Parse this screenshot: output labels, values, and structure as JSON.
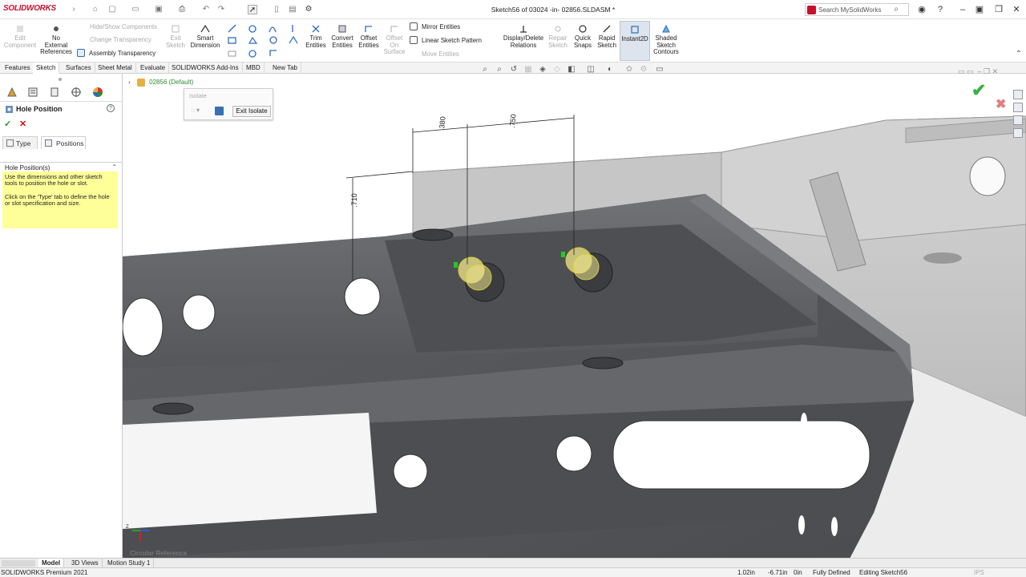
{
  "app": {
    "name": "SOLIDWORKS",
    "window_title": "Sketch56 of 03024 -in- 02856.SLDASM *"
  },
  "search": {
    "placeholder": "Search MySolidWorks"
  },
  "ribbon": {
    "edit_component": "Edit Component",
    "no_external_refs": "No External References",
    "hide_show": "Hide/Show Components",
    "change_transparency": "Change Transparency",
    "assembly_transparency": "Assembly Transparency",
    "exit_sketch": "Exit Sketch",
    "smart_dimension": "Smart Dimension",
    "trim": "Trim Entities",
    "convert": "Convert Entities",
    "offset": "Offset Entities",
    "offset_surface": "Offset On Surface",
    "mirror": "Mirror Entities",
    "linear_pattern": "Linear Sketch Pattern",
    "move_entities": "Move Entities",
    "display_delete": "Display/Delete Relations",
    "repair": "Repair Sketch",
    "quick_snaps": "Quick Snaps",
    "rapid_sketch": "Rapid Sketch",
    "instant2d": "Instant2D",
    "shaded_contours": "Shaded Sketch Contours"
  },
  "tabs": [
    "Features",
    "Sketch",
    "Surfaces",
    "Sheet Metal",
    "Evaluate",
    "SOLIDWORKS Add-Ins",
    "MBD",
    "New Tab"
  ],
  "active_tab": "Sketch",
  "tree": {
    "root": "02856  (Default)"
  },
  "isolate": {
    "label": "Isolate",
    "exit": "Exit Isolate"
  },
  "property_manager": {
    "title": "Hole Position",
    "help": "?",
    "ok": "✓",
    "cancel": "✕",
    "tab_type": "Type",
    "tab_positions": "Positions",
    "section": "Hole Position(s)",
    "note1": "Use the dimensions and other sketch tools to position the hole or slot.",
    "note2": "Click on the 'Type' tab to define the hole or slot specification and size."
  },
  "dimensions": {
    "d1": ".380",
    "d2": ".750",
    "d3": ".710"
  },
  "viewport": {
    "circular_reference": "Circular Reference",
    "triad_label": "Z"
  },
  "bottom_tabs": [
    "Model",
    "3D Views",
    "Motion Study 1"
  ],
  "status": {
    "product": "SOLIDWORKS Premium 2021",
    "x": "1.02in",
    "y": "-6.71in",
    "z": "0in",
    "state": "Fully Defined",
    "editing": "Editing Sketch56",
    "units": "IPS"
  },
  "colors": {
    "brand_red": "#c8102e",
    "accept_green": "#3cb043",
    "note_yellow": "#ffff99",
    "part_gray": "#5a5c60"
  }
}
